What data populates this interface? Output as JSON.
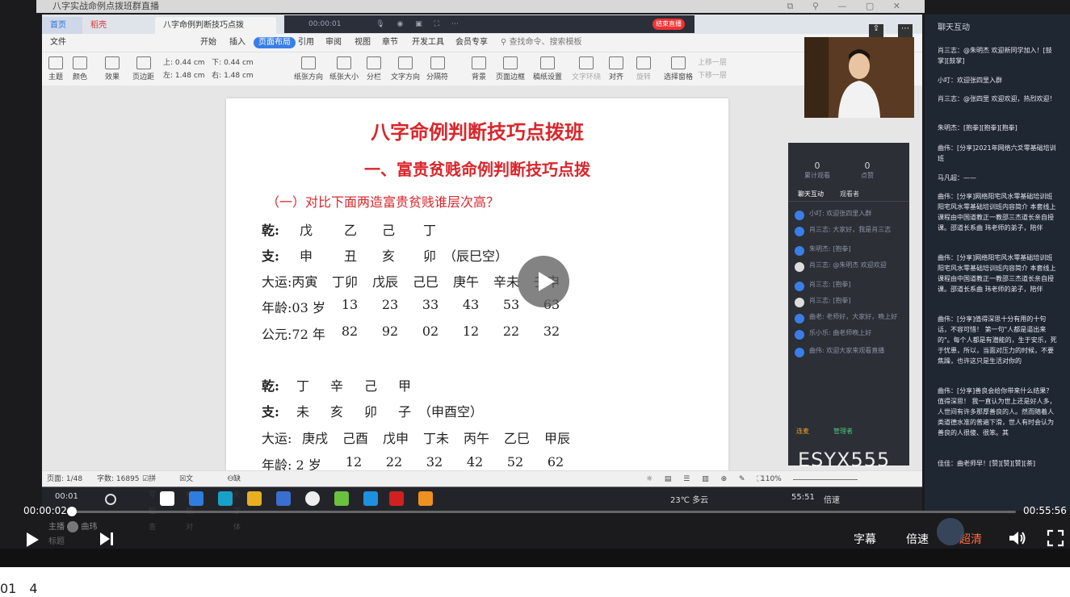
{
  "window": {
    "title": "八字实战命例点拨班群直播"
  },
  "wps": {
    "tabs": {
      "home": "首页",
      "recording": "稻壳",
      "document": "八字命例判断技巧点拨班.docx"
    },
    "meeting_timer": "00:00:01",
    "meeting_end": "结束直播",
    "menu": [
      "文件",
      "开始",
      "插入",
      "页面布局",
      "引用",
      "审阅",
      "视图",
      "章节",
      "开发工具",
      "会员专享"
    ],
    "active_menu": "页面布局",
    "search_placeholder": "查找命令、搜索模板",
    "ribbon": [
      {
        "label": "主题"
      },
      {
        "label": "颜色"
      },
      {
        "label": "效果"
      },
      {
        "label": "页边距"
      },
      {
        "label": "纸张方向"
      },
      {
        "label": "纸张大小"
      },
      {
        "label": "分栏"
      },
      {
        "label": "文字方向"
      },
      {
        "label": "分隔符"
      },
      {
        "label": "背景"
      },
      {
        "label": "页面边框"
      },
      {
        "label": "稿纸设置"
      },
      {
        "label": "文字环绕"
      },
      {
        "label": "对齐"
      },
      {
        "label": "旋转"
      },
      {
        "label": "选择窗格"
      },
      {
        "label": "上移一层"
      },
      {
        "label": "下移一层"
      }
    ],
    "margins": {
      "top_label": "上:",
      "top": "0.44 cm",
      "bottom_label": "下:",
      "bottom": "0.44 cm",
      "left_label": "左:",
      "left": "1.48 cm",
      "right_label": "右:",
      "right": "1.48 cm"
    },
    "status": {
      "page": "页面: 1/48",
      "words": "字数: 16895",
      "spell": "拼写检查",
      "proof": "文档校对",
      "font": "缺失字体",
      "zoom": "110%"
    }
  },
  "document": {
    "title": "八字命例判断技巧点拨班",
    "subtitle": "一、富贵贫贱命例判断技巧点拨",
    "question": "（一）对比下面两造富贵贫贱谁层次高？",
    "chart1": {
      "qian": {
        "label": "乾:",
        "cells": [
          "戊",
          "乙",
          "己",
          "丁"
        ]
      },
      "zhi": {
        "label": "支:",
        "cells": [
          "申",
          "丑",
          "亥",
          "卯",
          "（辰巳空）"
        ]
      },
      "dayun": {
        "label": "大运:丙寅",
        "cells": [
          "丁卯",
          "戊辰",
          "己巳",
          "庚午",
          "辛未",
          "壬申"
        ]
      },
      "age": {
        "label": "年龄:03 岁",
        "cells": [
          "13",
          "23",
          "33",
          "43",
          "53",
          "63"
        ]
      },
      "year": {
        "label": "公元:72 年",
        "cells": [
          "82",
          "92",
          "02",
          "12",
          "22",
          "32"
        ]
      }
    },
    "chart2": {
      "qian": {
        "label": "乾:",
        "cells": [
          "丁",
          "辛",
          "己",
          "甲"
        ]
      },
      "zhi": {
        "label": "支:",
        "cells": [
          "未",
          "亥",
          "卯",
          "子",
          "（申酉空）"
        ]
      },
      "dayun": {
        "label": "大运:",
        "cells": [
          "庚戌",
          "己酉",
          "戊申",
          "丁未",
          "丙午",
          "乙巳",
          "甲辰"
        ]
      },
      "age": {
        "label": "年龄: 2 岁",
        "cells": [
          "12",
          "22",
          "32",
          "42",
          "52",
          "62"
        ]
      }
    }
  },
  "live_panel": {
    "stats": [
      {
        "value": "0",
        "label": "累计观看"
      },
      {
        "value": "0",
        "label": "点赞"
      }
    ],
    "tabs": [
      "聊天互动",
      "观看者"
    ],
    "messages": [
      "小叮: 欢迎张四里入群",
      "肖三志: 大家好，我是肖三志",
      "朱明杰: [抱拳]",
      "肖三志: @朱明杰 欢迎欢迎",
      "肖三志: [抱拳]",
      "曲老: 老师好，大家好，晚上好",
      "乐小乐: 曲老师晚上好",
      "曲伟: 欢迎大家来观看直播"
    ],
    "bottom": [
      "连麦",
      "管理者"
    ],
    "watermark": "ESYX555"
  },
  "chat": {
    "title": "聊天互动",
    "messages": [
      "肖三志：@朱明杰 欢迎新同学加入！[鼓掌][鼓掌]",
      "小叮：欢迎张四里入群",
      "肖三志：@张四里 欢迎欢迎，热烈欢迎！",
      "朱明杰：[抱拳][抱拳][抱拳]",
      "曲伟：[分享]2021年网络六爻零基础培训班",
      "马凡超：——",
      "曲伟：[分享]网络阳宅风水零基础培训班 阳宅风水零基础培训班内容简介 本套线上课程由中国道教正一教邵三杰道长亲自授课。邵道长系曲 玮老师的弟子，陪伴",
      "曲伟：[分享]网络阳宅风水零基础培训班 阳宅风水零基础培训班内容简介 本套线上课程由中国道教正一教邵三杰道长亲自授课。邵道长系曲 玮老师的弟子，陪伴",
      "曲伟：[分享]值得深思十分有用的十句话，不容可惜！ 第一句\"人都是逼出来的\"。每个人都是有潜能的，生于安乐，死于忧患，所以，当面对压力的时候，不要焦躁，也许这只是生活对你的",
      "曲伟：[分享]善良会给你带来什么结果？值得深思！ 我一直认为世上还是好人多，人世间有许多那厚善良的人。然而随着人类道德水准的普遍下滑，世人有时会认为善良的人很傻、很笨。其",
      "佳佳：曲老师早！[赞][赞][赞][茶]"
    ]
  },
  "inner_taskbar": {
    "elapsed": "00:01",
    "weather": "23℃ 多云",
    "elapsed_right": "55:51",
    "speed": "倍速"
  },
  "player": {
    "current": "00:00:02",
    "duration": "00:55:56",
    "progress": 0.0006,
    "subtitle": "字幕",
    "speed": "倍速",
    "quality": "超清",
    "quality_color": "#ff6a3a",
    "host_label": "主播",
    "host_name": "曲玮",
    "bottom_label": "标题"
  },
  "below": {
    "text": "01　4"
  }
}
